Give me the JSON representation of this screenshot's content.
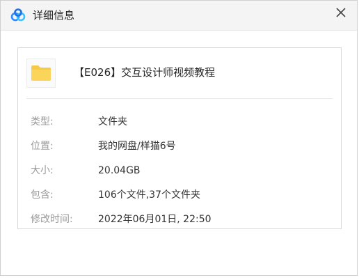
{
  "window": {
    "title": "详细信息",
    "logo_icon": "baidu-netdisk-logo",
    "close_icon": "close-icon"
  },
  "file": {
    "icon": "folder-icon",
    "name": "【E026】交互设计师视频教程"
  },
  "details": [
    {
      "label": "类型:",
      "value": "文件夹"
    },
    {
      "label": "位置:",
      "value": "我的网盘/样猫6号"
    },
    {
      "label": "大小:",
      "value": "20.04GB"
    },
    {
      "label": "包含:",
      "value": "106个文件,37个文件夹"
    },
    {
      "label": "修改时间:",
      "value": "2022年06月01日, 22:50"
    }
  ],
  "colors": {
    "folder": "#f7c948",
    "logo_blue": "#2f8bff",
    "logo_cyan": "#36c4ff"
  }
}
